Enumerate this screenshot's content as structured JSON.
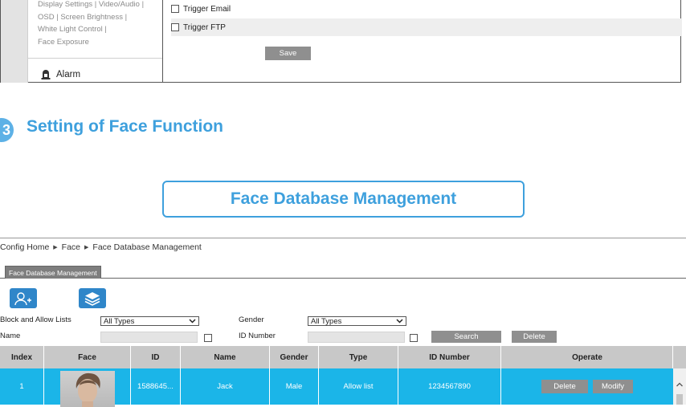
{
  "top_panel": {
    "side_text_lines": [
      "Display Settings | Video/Audio |",
      "OSD | Screen Brightness |",
      "White Light Control |",
      "Face Exposure"
    ],
    "alarm_label": "Alarm",
    "options": [
      "Trigger Email",
      "Trigger FTP"
    ],
    "save_label": "Save"
  },
  "section": {
    "number": "3",
    "title": "Setting of Face Function"
  },
  "feature_tag": "Face Database Management",
  "app": {
    "breadcrumb": [
      "Config Home",
      "Face",
      "Face Database Management"
    ],
    "tab_label": "Face Database Management",
    "icons": [
      "add-user-icon",
      "layers-icon"
    ],
    "filters": {
      "list_label": "Block and Allow Lists",
      "list_value": "All Types",
      "gender_label": "Gender",
      "gender_value": "All Types",
      "name_label": "Name",
      "id_label": "ID Number",
      "search_label": "Search",
      "delete_label": "Delete"
    },
    "table": {
      "headers": [
        "Index",
        "Face",
        "ID",
        "Name",
        "Gender",
        "Type",
        "ID Number",
        "Operate"
      ],
      "rows": [
        {
          "index": "1",
          "id": "1588645...",
          "name": "Jack",
          "gender": "Male",
          "type": "Allow list",
          "id_number": "1234567890",
          "delete_label": "Delete",
          "modify_label": "Modify"
        }
      ]
    }
  },
  "colors": {
    "accent_blue": "#3ea0dd",
    "row_highlight": "#1bb5e8",
    "button_gray": "#8f8f8f",
    "icon_button_blue": "#2f86c9"
  }
}
